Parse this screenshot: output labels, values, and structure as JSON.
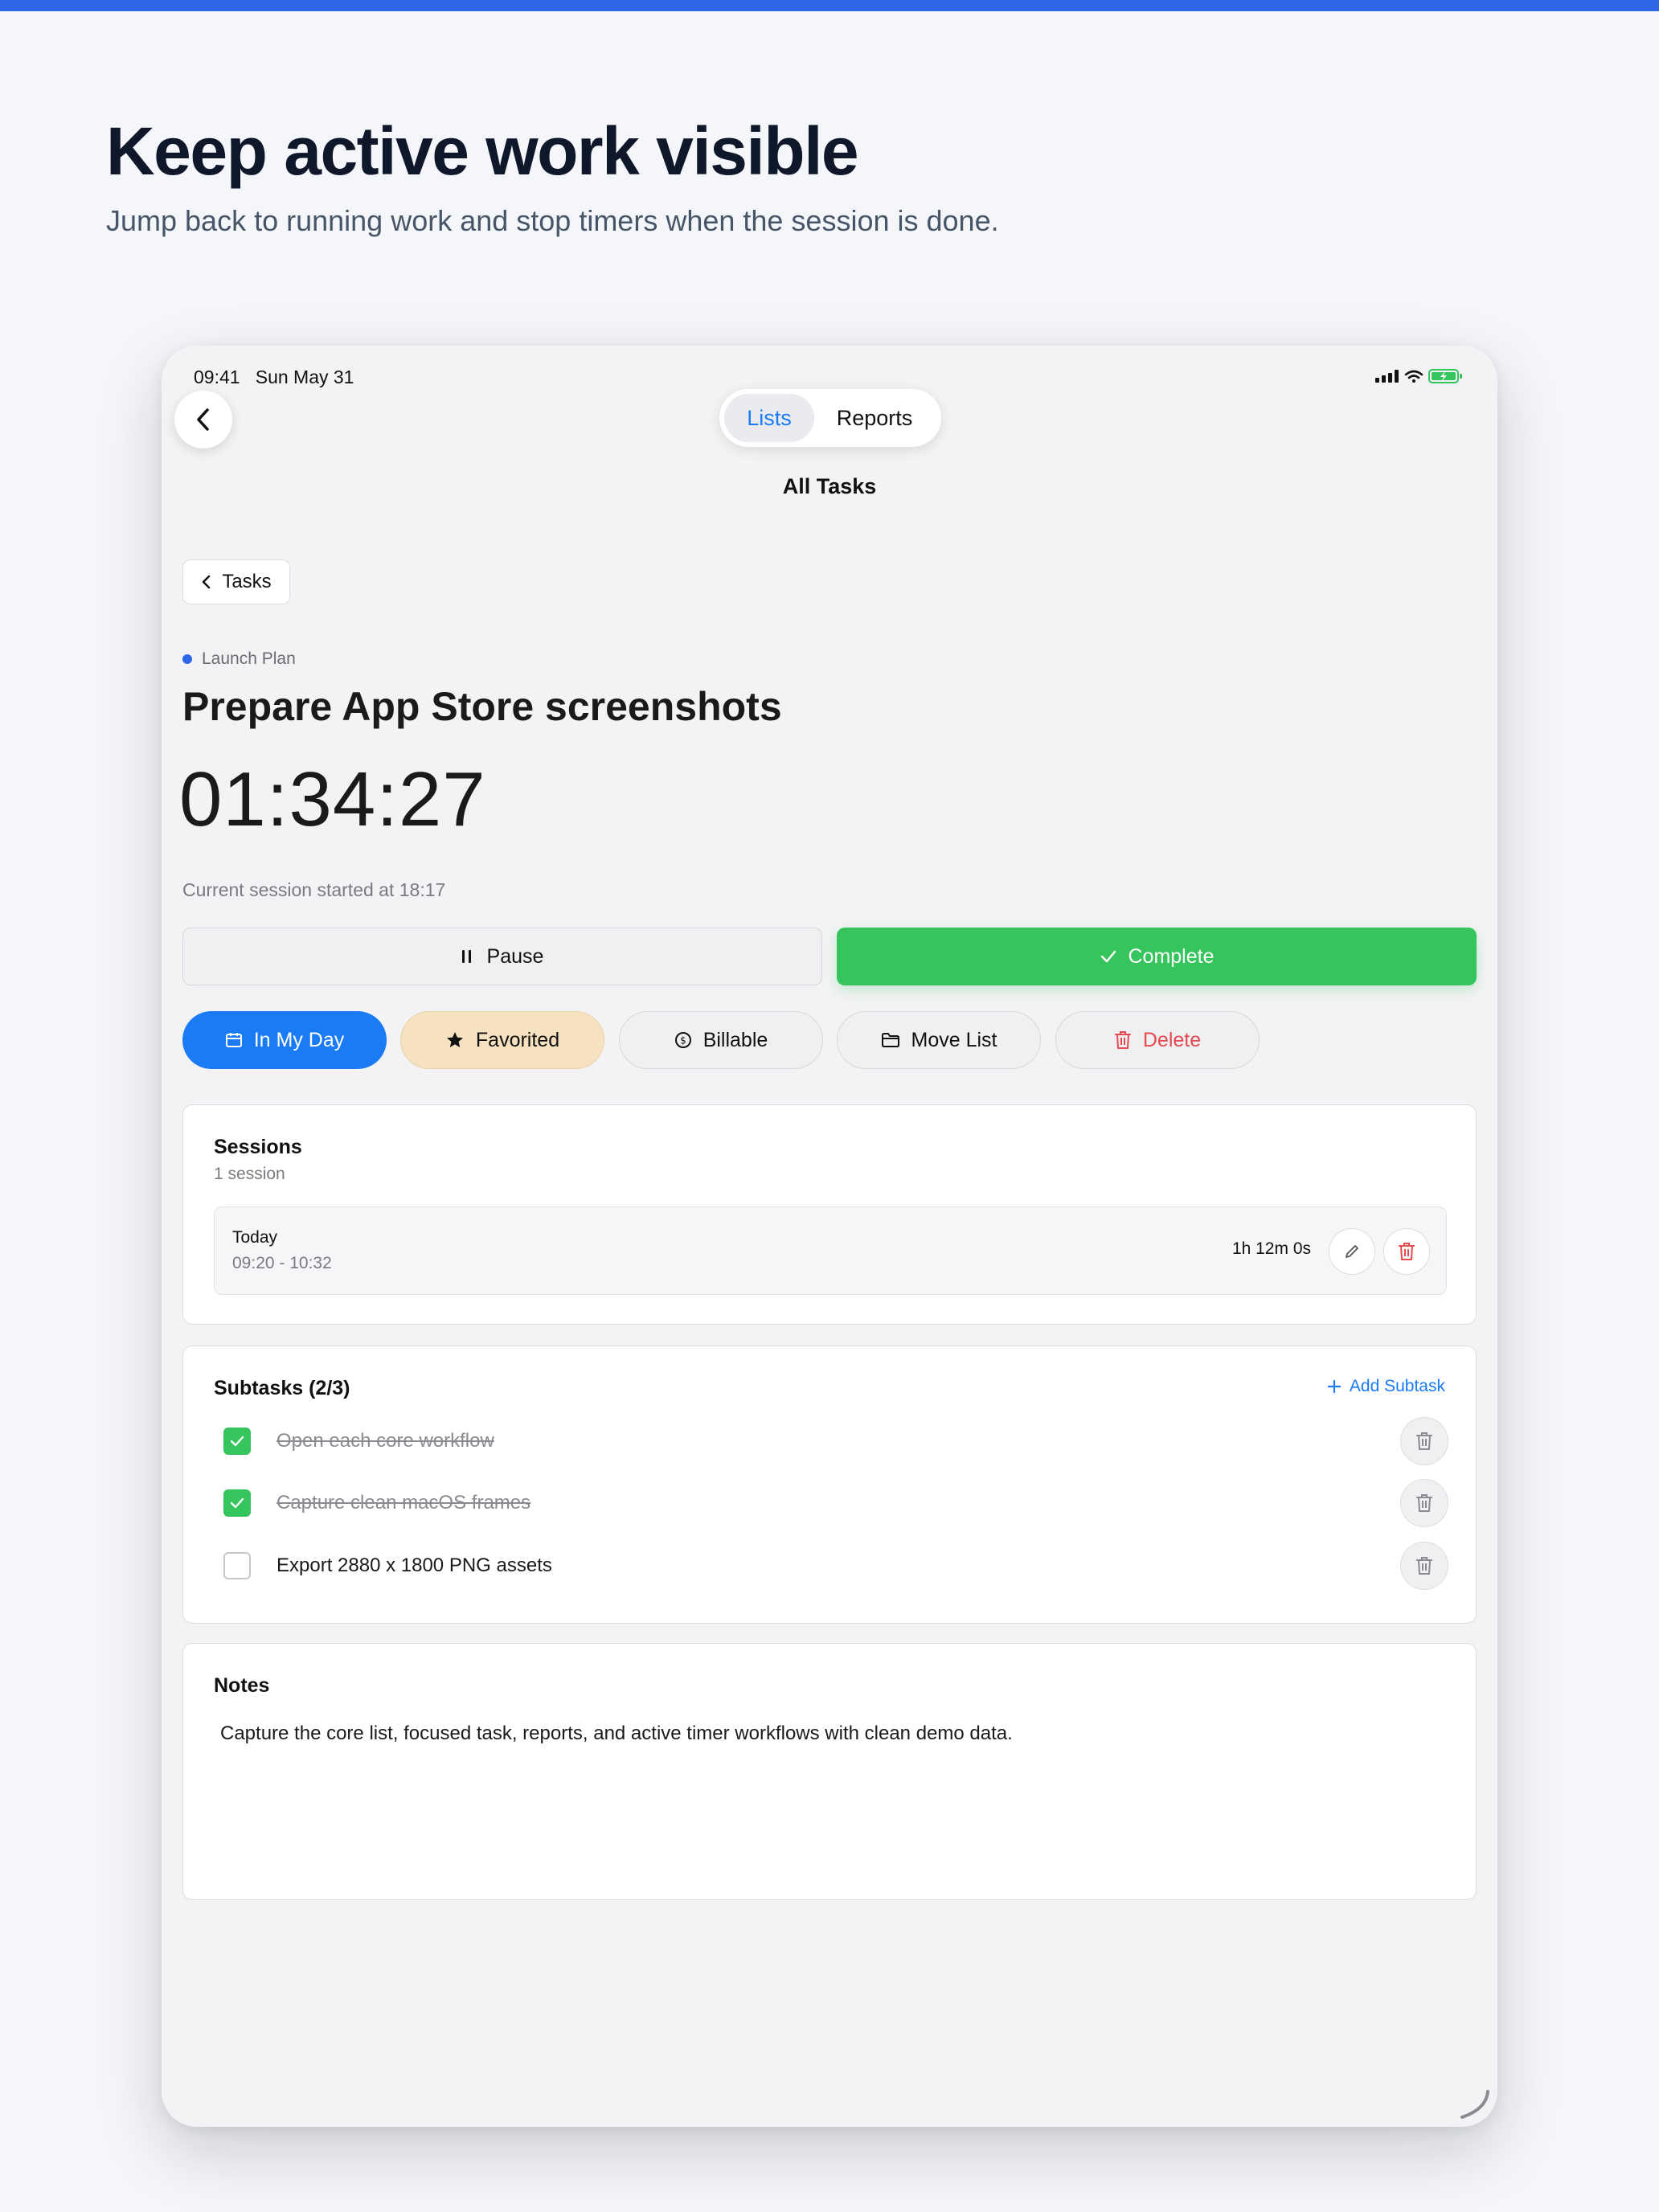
{
  "hero": {
    "title": "Keep active work visible",
    "subtitle": "Jump back to running work and stop timers when the session is done."
  },
  "status_bar": {
    "time": "09:41",
    "date": "Sun May 31"
  },
  "nav": {
    "tabs": [
      {
        "label": "Lists",
        "active": true
      },
      {
        "label": "Reports",
        "active": false
      }
    ],
    "title": "All Tasks",
    "breadcrumb": "Tasks"
  },
  "task": {
    "list_name": "Launch Plan",
    "title": "Prepare App Store screenshots",
    "timer": "01:34:27",
    "session_started": "Current session started at 18:17"
  },
  "actions": {
    "pause_label": "Pause",
    "complete_label": "Complete"
  },
  "chips": {
    "my_day": "In My Day",
    "favorited": "Favorited",
    "billable": "Billable",
    "move_list": "Move List",
    "delete": "Delete"
  },
  "sessions": {
    "title": "Sessions",
    "count_label": "1 session",
    "items": [
      {
        "day": "Today",
        "range": "09:20 - 10:32",
        "duration": "1h 12m 0s"
      }
    ]
  },
  "subtasks": {
    "title": "Subtasks (2/3)",
    "add_label": "Add Subtask",
    "items": [
      {
        "text": "Open each core workflow",
        "done": true
      },
      {
        "text": "Capture clean macOS frames",
        "done": true
      },
      {
        "text": "Export 2880 x 1800 PNG assets",
        "done": false
      }
    ]
  },
  "notes": {
    "title": "Notes",
    "text": "Capture the core list, focused task, reports, and active timer workflows with clean demo data."
  },
  "colors": {
    "accent_blue": "#1a7bf5",
    "brand_stripe": "#2f67e8",
    "complete_green": "#36c45c",
    "favorite_bg": "#f6e2c0",
    "delete_red": "#e5484d"
  },
  "icons": {
    "back": "chevron-left-icon",
    "pause": "pause-icon",
    "complete": "checkmark-icon",
    "my_day": "calendar-icon",
    "favorited": "star-icon",
    "billable": "dollar-circle-icon",
    "move_list": "folder-icon",
    "delete": "trash-icon",
    "edit": "pencil-icon",
    "add": "plus-icon"
  }
}
